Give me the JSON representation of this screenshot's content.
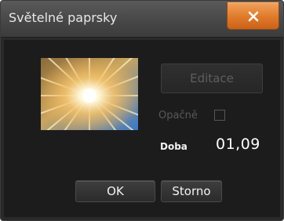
{
  "window": {
    "title": "Světelné paprsky",
    "close_symbol": "✕"
  },
  "preview": {
    "image_name": "light-rays-thumbnail",
    "icon": "light-rays-preview-icon"
  },
  "controls": {
    "edit_label": "Editace",
    "reverse_label": "Opačně",
    "reverse_checked": false,
    "duration_label": "Doba",
    "duration_value": "01,09"
  },
  "buttons": {
    "ok_label": "OK",
    "cancel_label": "Storno"
  },
  "colors": {
    "close_accent": "#e07a2a",
    "dialog_bg": "#1c1c1c",
    "titlebar_bg": "#464646"
  }
}
